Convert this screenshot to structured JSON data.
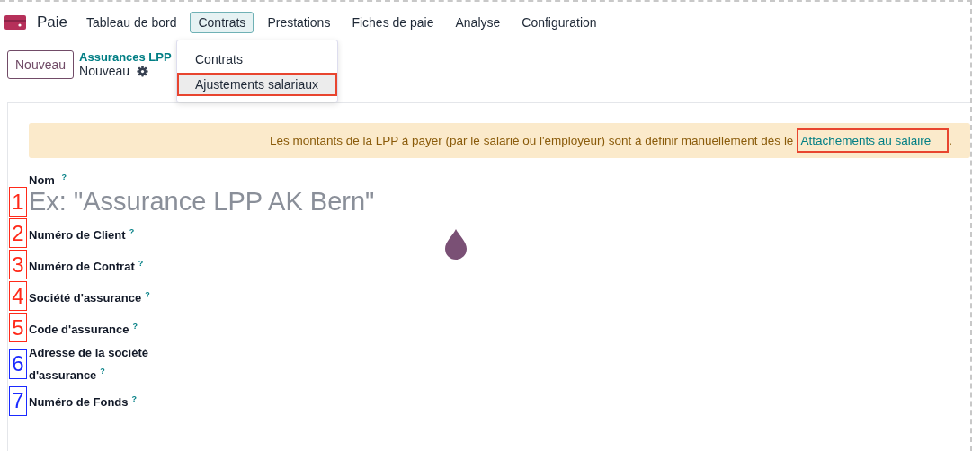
{
  "app": {
    "name": "Paie"
  },
  "menu": [
    {
      "label": "Tableau de bord",
      "selected": false
    },
    {
      "label": "Contrats",
      "selected": true
    },
    {
      "label": "Prestations",
      "selected": false
    },
    {
      "label": "Fiches de paie",
      "selected": false
    },
    {
      "label": "Analyse",
      "selected": false
    },
    {
      "label": "Configuration",
      "selected": false
    }
  ],
  "dropdown": [
    {
      "label": "Contrats",
      "highlighted": false
    },
    {
      "label": "Ajustements salariaux",
      "highlighted": true
    }
  ],
  "new_button": "Nouveau",
  "breadcrumb": {
    "parent": "Assurances LPP",
    "current": "Nouveau"
  },
  "alert": {
    "text": "Les montants de la LPP à payer (par le salarié ou l'employeur) sont à définir manuellement dès le",
    "link": "Attachements au salaire",
    "link_highlighted": true,
    "after": "."
  },
  "name_field": {
    "label": "Nom",
    "help": "?",
    "marker": "1",
    "color": "#ff2a1a",
    "placeholder": "Ex: \"Assurance LPP AK Bern\""
  },
  "fields": [
    {
      "marker": "2",
      "color": "#ff2a1a",
      "label": "Numéro de Client",
      "help": "?"
    },
    {
      "marker": "3",
      "color": "#ff2a1a",
      "label": "Numéro de Contrat",
      "help": "?"
    },
    {
      "marker": "4",
      "color": "#ff2a1a",
      "label": "Société d'assurance",
      "help": "?"
    },
    {
      "marker": "5",
      "color": "#ff2a1a",
      "label": "Code d'assurance",
      "help": "?"
    },
    {
      "marker": "6",
      "color": "#1a2aff",
      "label": "Adresse de la société d'assurance",
      "help": "?"
    },
    {
      "marker": "7",
      "color": "#1a2aff",
      "label": "Numéro de Fonds",
      "help": "?"
    }
  ]
}
